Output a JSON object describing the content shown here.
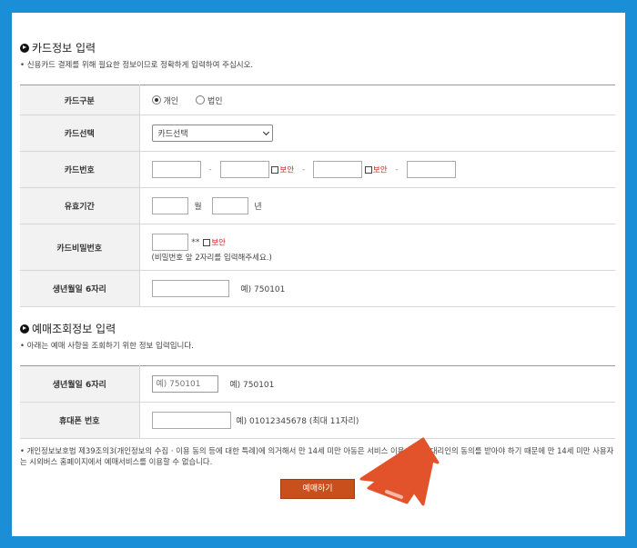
{
  "card_section": {
    "title": "카드정보 입력",
    "desc": "• 신용카드 결제를 위해 필요한 정보이므로 정확하게 입력하여 주십시오.",
    "rows": {
      "type": {
        "label": "카드구분",
        "options": [
          "개인",
          "법인"
        ]
      },
      "select": {
        "label": "카드선택",
        "value": "카드선택"
      },
      "number": {
        "label": "카드번호",
        "secure_label": "보안",
        "dash": "-"
      },
      "expiry": {
        "label": "유효기간",
        "month_unit": "월",
        "year_unit": "년"
      },
      "password": {
        "label": "카드비밀번호",
        "mask": "**",
        "secure_label": "보안",
        "hint": "(비밀번호 앞 2자리를 입력해주세요.)"
      },
      "birth": {
        "label": "생년월일 6자리",
        "example": "예) 750101"
      }
    }
  },
  "booking_section": {
    "title": "예매조회정보 입력",
    "desc": "• 아래는 예매 사항을 조회하기 위한 정보 입력입니다.",
    "rows": {
      "birth": {
        "label": "생년월일 6자리",
        "placeholder": "예) 750101",
        "example": "예) 750101"
      },
      "phone": {
        "label": "휴대폰 번호",
        "example": "예) 01012345678 (최대 11자리)"
      }
    }
  },
  "notice": "• 개인정보보호법 제39조의3(개인정보의 수집 · 이용 동의 등에 대한 특례)에 의거해서 만 14세 미만 아동은 서비스 이용 시 법정대리인의 동의를 받아야 하기 때문에 만 14세 미만 사용자는 시외버스 홈페이지에서 예매서비스를 이용할 수 없습니다.",
  "submit_label": "예매하기",
  "colors": {
    "frame": "#1a8fd8",
    "button": "#c9501c",
    "arrow": "#e2532b",
    "secure": "#d21d1d"
  }
}
